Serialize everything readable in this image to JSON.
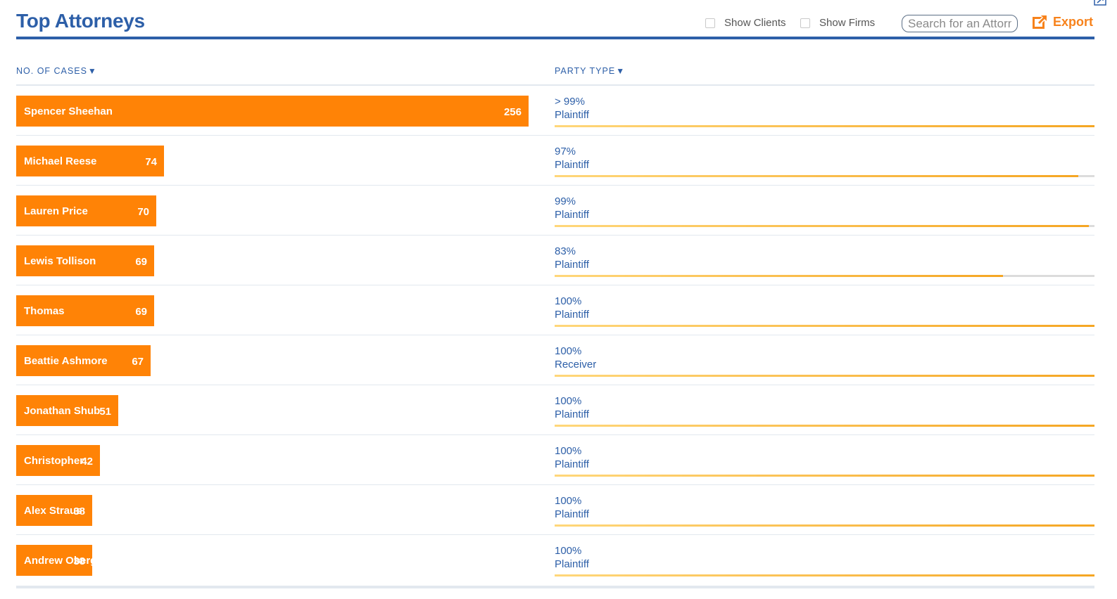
{
  "header": {
    "title": "Top Attorneys",
    "show_clients_label": "Show Clients",
    "show_firms_label": "Show Firms",
    "search_placeholder": "Search for an Attorney",
    "export_label": "Export"
  },
  "columns": {
    "cases": "NO. OF CASES",
    "party_type": "PARTY TYPE",
    "sort_indicator": "▼"
  },
  "colors": {
    "accent": "#2d5fa8",
    "bar": "#ff8306",
    "export": "#f7821b"
  },
  "chart_data": {
    "type": "bar",
    "orientation": "horizontal",
    "categories": [
      "Spencer Sheehan",
      "Michael Reese",
      "Lauren Price",
      "Lewis Tollison",
      "Thomas",
      "Beattie Ashmore",
      "Jonathan Shub",
      "Christopher",
      "Alex Straus",
      "Andrew Obergfell"
    ],
    "values": [
      256,
      74,
      70,
      69,
      69,
      67,
      51,
      42,
      38,
      38
    ],
    "xmax": 256
  },
  "rows": [
    {
      "name": "Spencer Sheehan",
      "count": "256",
      "value": 256,
      "pct_label": "> 99%",
      "party": "Plaintiff",
      "pct": 100
    },
    {
      "name": "Michael Reese",
      "count": "74",
      "value": 74,
      "pct_label": "97%",
      "party": "Plaintiff",
      "pct": 97
    },
    {
      "name": "Lauren Price",
      "count": "70",
      "value": 70,
      "pct_label": "99%",
      "party": "Plaintiff",
      "pct": 99
    },
    {
      "name": "Lewis Tollison",
      "count": "69",
      "value": 69,
      "pct_label": "83%",
      "party": "Plaintiff",
      "pct": 83
    },
    {
      "name": "Thomas",
      "count": "69",
      "value": 69,
      "pct_label": "100%",
      "party": "Plaintiff",
      "pct": 100
    },
    {
      "name": "Beattie Ashmore",
      "count": "67",
      "value": 67,
      "pct_label": "100%",
      "party": "Receiver",
      "pct": 100
    },
    {
      "name": "Jonathan Shub",
      "count": "51",
      "value": 51,
      "pct_label": "100%",
      "party": "Plaintiff",
      "pct": 100
    },
    {
      "name": "Christopher",
      "count": "42",
      "value": 42,
      "pct_label": "100%",
      "party": "Plaintiff",
      "pct": 100
    },
    {
      "name": "Alex Straus",
      "count": "38",
      "value": 38,
      "pct_label": "100%",
      "party": "Plaintiff",
      "pct": 100
    },
    {
      "name": "Andrew Obergfell",
      "count": "38",
      "value": 38,
      "pct_label": "100%",
      "party": "Plaintiff",
      "pct": 100
    }
  ]
}
